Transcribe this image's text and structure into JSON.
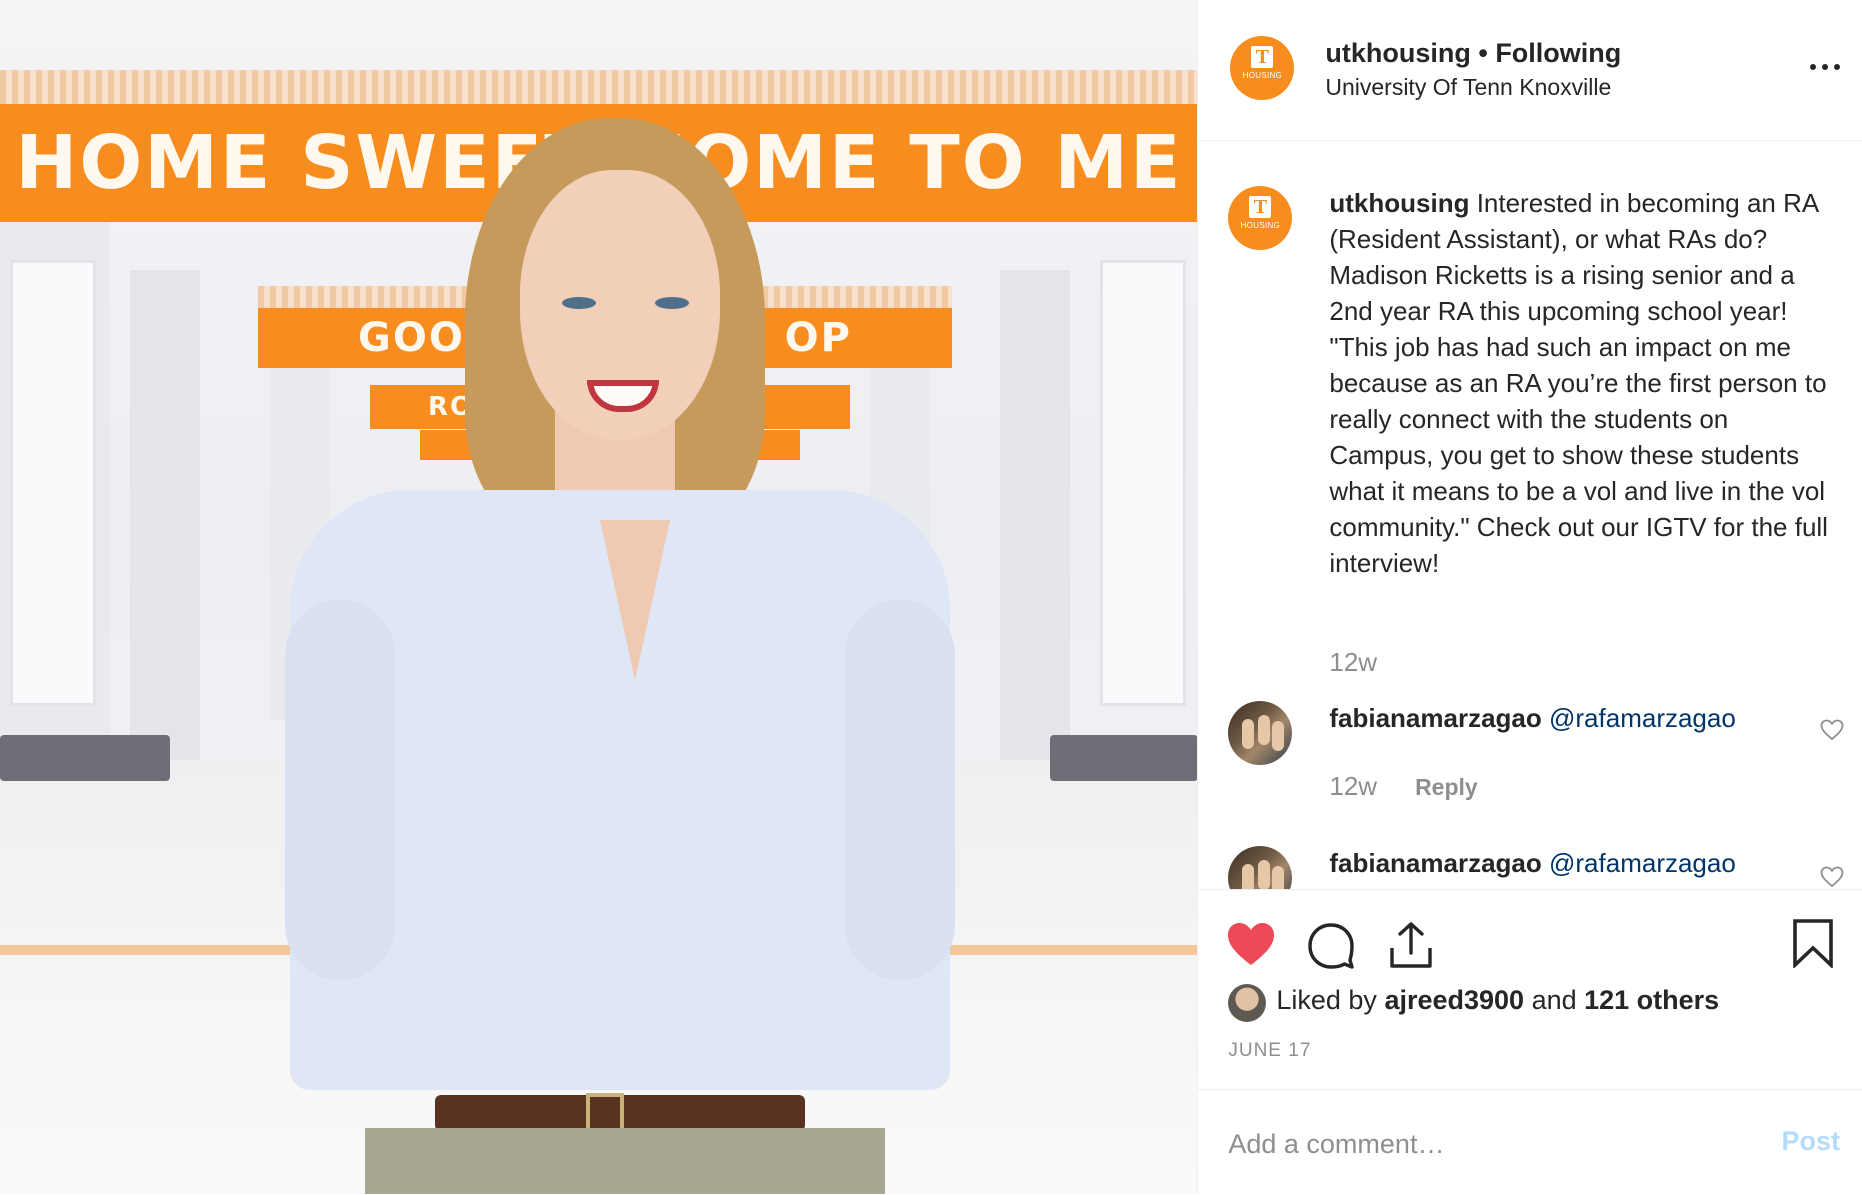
{
  "photo": {
    "banner_main": "HOME SWEET HOME TO ME",
    "banner_second": "GOOD",
    "banner_second_right": "OP",
    "banner_third": "RO",
    "accent_color": "#f78c1f"
  },
  "header": {
    "username": "utkhousing",
    "separator": " • ",
    "follow_status": "Following",
    "location": "University Of Tenn Knoxville",
    "avatar_letter": "T",
    "avatar_sub": "HOUSING"
  },
  "caption": {
    "username": "utkhousing",
    "text": "Interested in becoming an RA (Resident Assistant), or what RAs do? Madison Ricketts is a rising senior and a 2nd year RA this upcoming school year! \"This job has had such an impact on me because as an RA you’re the first person to really connect with the students on Campus, you get to show these students what it means to be a vol and live in the vol community.\" Check out our IGTV for the full interview!",
    "time": "12w"
  },
  "comments": [
    {
      "username": "fabianamarzagao",
      "mention": "@rafamarzagao",
      "time": "12w",
      "reply": "Reply"
    },
    {
      "username": "fabianamarzagao",
      "mention": "@rafamarzagao"
    }
  ],
  "likes": {
    "prefix": "Liked by ",
    "user": "ajreed3900",
    "middle": " and ",
    "others": "121 others"
  },
  "date": "JUNE 17",
  "add_comment": {
    "placeholder": "Add a comment…",
    "post_label": "Post"
  },
  "icons": {
    "like": "heart-filled-icon",
    "comment": "comment-bubble-icon",
    "share": "share-icon",
    "save": "bookmark-icon",
    "more": "more-horizontal-icon"
  },
  "colors": {
    "like_red": "#ed4956",
    "mention_blue": "#003569",
    "post_disabled": "#b3dbff",
    "muted_gray": "#8e8e8e"
  }
}
